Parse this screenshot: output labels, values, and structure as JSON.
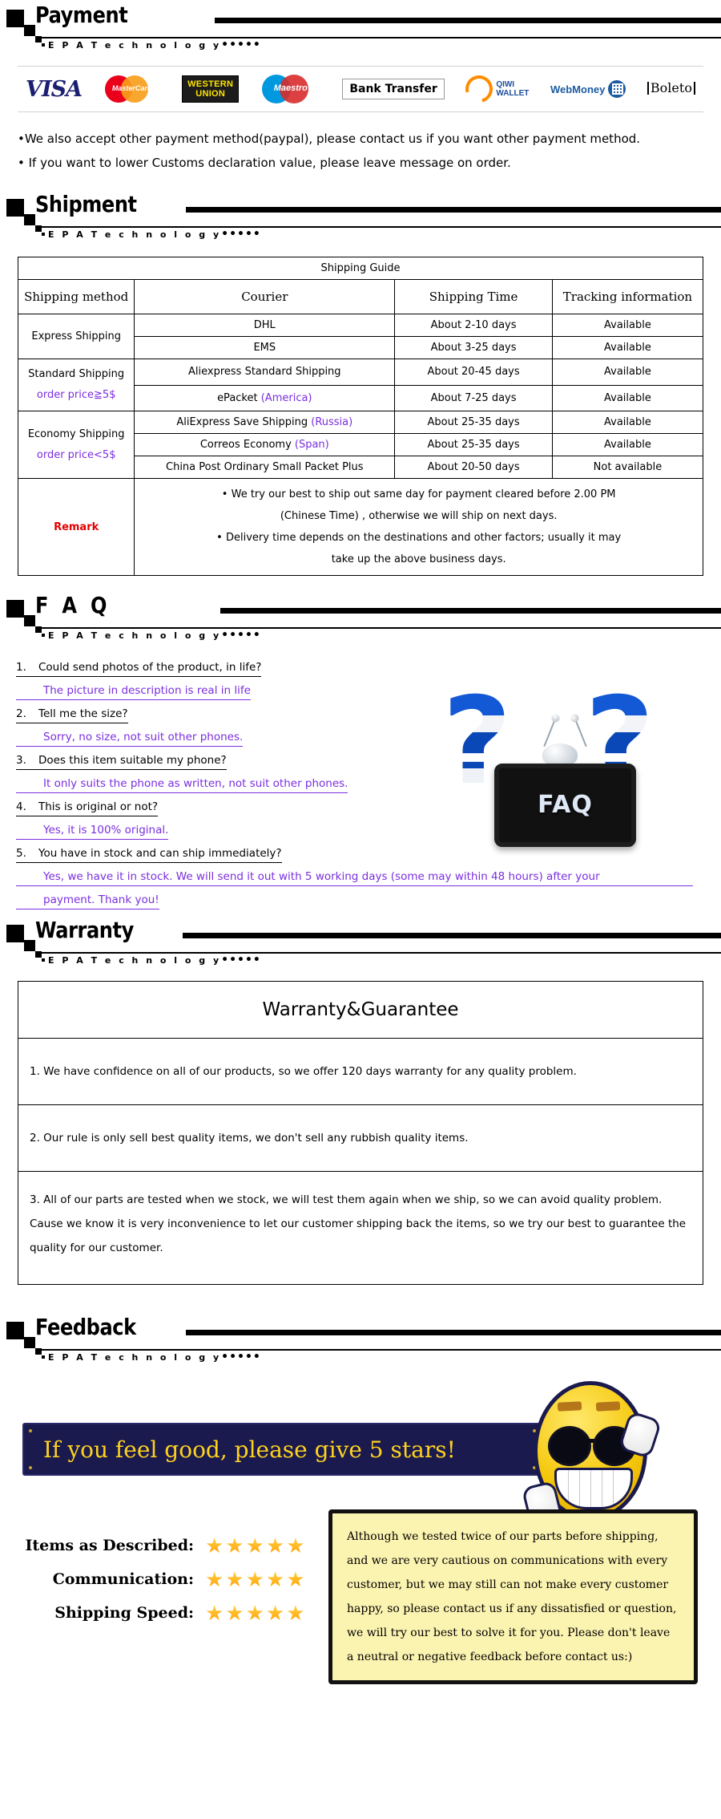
{
  "brand_sub": "E P A  T e c h n o l o g y",
  "brand_dots": "•••••",
  "sections": {
    "payment": {
      "title": "Payment"
    },
    "shipment": {
      "title": "Shipment"
    },
    "faq": {
      "title": "F A Q"
    },
    "warranty": {
      "title": "Warranty"
    },
    "feedback": {
      "title": "Feedback"
    }
  },
  "payment": {
    "methods": [
      {
        "name": "visa-logo",
        "label": "VISA"
      },
      {
        "name": "mastercard-logo",
        "label": "MasterCard"
      },
      {
        "name": "western-union-logo",
        "label_top": "WESTERN",
        "label_bottom": "UNION"
      },
      {
        "name": "maestro-logo",
        "label": "Maestro"
      },
      {
        "name": "bank-transfer-logo",
        "label": "Bank Transfer"
      },
      {
        "name": "qiwi-wallet-logo",
        "label_top": "QIWI",
        "label_bottom": "WALLET"
      },
      {
        "name": "webmoney-logo",
        "label": "WebMoney"
      },
      {
        "name": "boleto-logo",
        "label": "Boleto"
      }
    ],
    "notes": [
      "•We also accept other payment method(paypal), please contact us if you want other payment method.",
      "• If you want to lower Customs declaration value, please leave message on order."
    ]
  },
  "shipping": {
    "guide_title": "Shipping Guide",
    "headers": [
      "Shipping method",
      "Courier",
      "Shipping Time",
      "Tracking information"
    ],
    "groups": [
      {
        "method": "Express Shipping",
        "method_note": "",
        "rows": [
          {
            "courier": "DHL",
            "courier_extra": "",
            "time": "About 2-10 days",
            "tracking": "Available"
          },
          {
            "courier": "EMS",
            "courier_extra": "",
            "time": "About 3-25 days",
            "tracking": "Available"
          }
        ]
      },
      {
        "method": "Standard Shipping",
        "method_note": "order price≧5$",
        "rows": [
          {
            "courier": "Aliexpress Standard Shipping",
            "courier_extra": "",
            "time": "About 20-45 days",
            "tracking": "Available"
          },
          {
            "courier": "ePacket ",
            "courier_extra": "(America)",
            "time": "About 7-25 days",
            "tracking": "Available"
          }
        ]
      },
      {
        "method": "Economy Shipping",
        "method_note": "order price<5$",
        "rows": [
          {
            "courier": "AliExpress Save Shipping ",
            "courier_extra": "(Russia)",
            "time": "About 25-35 days",
            "tracking": "Available"
          },
          {
            "courier": "Correos Economy ",
            "courier_extra": "(Span)",
            "time": "About 25-35 days",
            "tracking": "Available"
          },
          {
            "courier": "China Post Ordinary Small Packet Plus",
            "courier_extra": "",
            "time": "About 20-50 days",
            "tracking": "Not available"
          }
        ]
      }
    ],
    "remark_label": "Remark",
    "remark_lines": [
      "• We try our best to ship out same day for payment cleared before 2.00 PM",
      "(Chinese Time) , otherwise we will ship on next days.",
      "• Delivery time depends on the destinations and other factors; usually it may",
      " take up the above business days."
    ]
  },
  "faq": {
    "items": [
      {
        "num": "1.",
        "question": "Could send photos of the product, in life?",
        "answer": "The picture in description is real in life"
      },
      {
        "num": "2.",
        "question": "Tell me the size?",
        "answer": "Sorry, no size, not suit other phones."
      },
      {
        "num": "3.",
        "question": "Does this item suitable my phone?",
        "answer": "It only suits the phone as written, not suit other phones."
      },
      {
        "num": "4.",
        "question": "This is original or not?",
        "answer": "Yes, it is 100% original."
      },
      {
        "num": "5.",
        "question": "You have in stock and can ship immediately?",
        "answer": "Yes, we have it in stock. We will send it out with 5 working days (some may within 48 hours) after your",
        "answer2": "payment. Thank you!"
      }
    ],
    "image_label": "FAQ",
    "question_mark": "?"
  },
  "warranty": {
    "title": "Warranty&Guarantee",
    "items": [
      "1. We have confidence on all of our products, so we offer 120 days warranty for any quality problem.",
      "2. Our rule is only sell best quality items, we don't sell any rubbish quality items.",
      "3. All of our parts are tested when we stock, we will test them again when we  ship, so we can avoid quality problem. Cause we know it is very inconvenience to let our customer shipping back the items, so we try our best to guarantee the quality for our customer."
    ]
  },
  "feedback": {
    "banner_text": "If you feel good, please give 5 stars!",
    "ratings": [
      {
        "label": "Items as Described:",
        "stars": "★★★★★",
        "value": 5
      },
      {
        "label": "Communication:",
        "stars": "★★★★★",
        "value": 5
      },
      {
        "label": "Shipping Speed:",
        "stars": "★★★★★",
        "value": 5
      }
    ],
    "note": "Although we tested twice of our parts before shipping, and we are very cautious on communications with every customer, but we may still can not make every customer happy, so please contact us if any dissatisfied or question, we will try our best to solve it for you. Please don't leave a neutral or negative feedback before contact us:)",
    "colors": {
      "banner_bg": "#1a1a4e",
      "banner_text": "#ffd21e",
      "note_bg": "#fbf3b0",
      "star": "#ffa500"
    }
  }
}
